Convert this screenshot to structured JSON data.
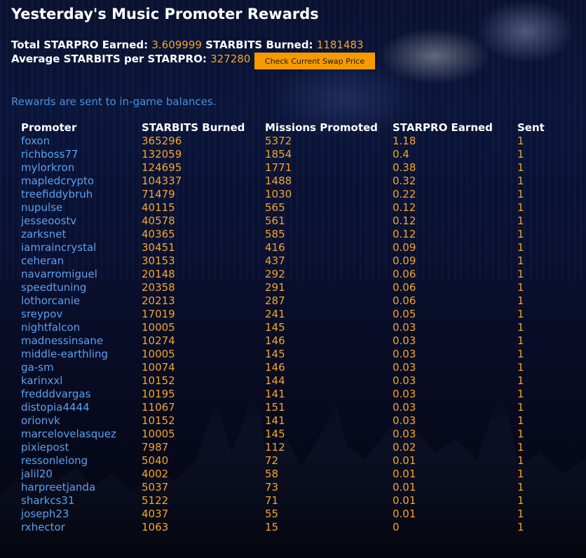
{
  "page": {
    "title": "Yesterday's Music Promoter Rewards",
    "stats": {
      "total_label": "Total STARPRO Earned:",
      "total_value": "3.609999",
      "burned_label": "STARBITS Burned:",
      "burned_value": "1181483",
      "average_label": "Average STARBITS per STARPRO:",
      "average_value": "327280"
    },
    "swap_button": "Check Current Swap Price",
    "notice": "Rewards are sent to in-game balances.",
    "colors": {
      "accent_orange": "#f5a623",
      "link_blue": "#5aa0ee",
      "button": "#f59b00"
    }
  },
  "table": {
    "headers": [
      "Promoter",
      "STARBITS Burned",
      "Missions Promoted",
      "STARPRO Earned",
      "Sent"
    ],
    "rows": [
      [
        "foxon",
        "365296",
        "5372",
        "1.18",
        "1"
      ],
      [
        "richboss77",
        "132059",
        "1854",
        "0.4",
        "1"
      ],
      [
        "mylorkron",
        "124695",
        "1771",
        "0.38",
        "1"
      ],
      [
        "mapledcrypto",
        "104337",
        "1488",
        "0.32",
        "1"
      ],
      [
        "treefiddybruh",
        "71479",
        "1030",
        "0.22",
        "1"
      ],
      [
        "nupulse",
        "40115",
        "565",
        "0.12",
        "1"
      ],
      [
        "jesseoostv",
        "40578",
        "561",
        "0.12",
        "1"
      ],
      [
        "zarksnet",
        "40365",
        "585",
        "0.12",
        "1"
      ],
      [
        "iamraincrystal",
        "30451",
        "416",
        "0.09",
        "1"
      ],
      [
        "ceheran",
        "30153",
        "437",
        "0.09",
        "1"
      ],
      [
        "navarromiguel",
        "20148",
        "292",
        "0.06",
        "1"
      ],
      [
        "speedtuning",
        "20358",
        "291",
        "0.06",
        "1"
      ],
      [
        "lothorcanie",
        "20213",
        "287",
        "0.06",
        "1"
      ],
      [
        "sreypov",
        "17019",
        "241",
        "0.05",
        "1"
      ],
      [
        "nightfalcon",
        "10005",
        "145",
        "0.03",
        "1"
      ],
      [
        "madnessinsane",
        "10274",
        "146",
        "0.03",
        "1"
      ],
      [
        "middle-earthling",
        "10005",
        "145",
        "0.03",
        "1"
      ],
      [
        "ga-sm",
        "10074",
        "146",
        "0.03",
        "1"
      ],
      [
        "karinxxl",
        "10152",
        "144",
        "0.03",
        "1"
      ],
      [
        "fredddvargas",
        "10195",
        "141",
        "0.03",
        "1"
      ],
      [
        "distopia4444",
        "11067",
        "151",
        "0.03",
        "1"
      ],
      [
        "orionvk",
        "10152",
        "141",
        "0.03",
        "1"
      ],
      [
        "marcelovelasquez",
        "10005",
        "145",
        "0.03",
        "1"
      ],
      [
        "pixiepost",
        "7987",
        "112",
        "0.02",
        "1"
      ],
      [
        "ressonlelong",
        "5040",
        "72",
        "0.01",
        "1"
      ],
      [
        "jalil20",
        "4002",
        "58",
        "0.01",
        "1"
      ],
      [
        "harpreetjanda",
        "5037",
        "73",
        "0.01",
        "1"
      ],
      [
        "sharkcs31",
        "5122",
        "71",
        "0.01",
        "1"
      ],
      [
        "joseph23",
        "4037",
        "55",
        "0.01",
        "1"
      ],
      [
        "rxhector",
        "1063",
        "15",
        "0",
        "1"
      ]
    ]
  }
}
